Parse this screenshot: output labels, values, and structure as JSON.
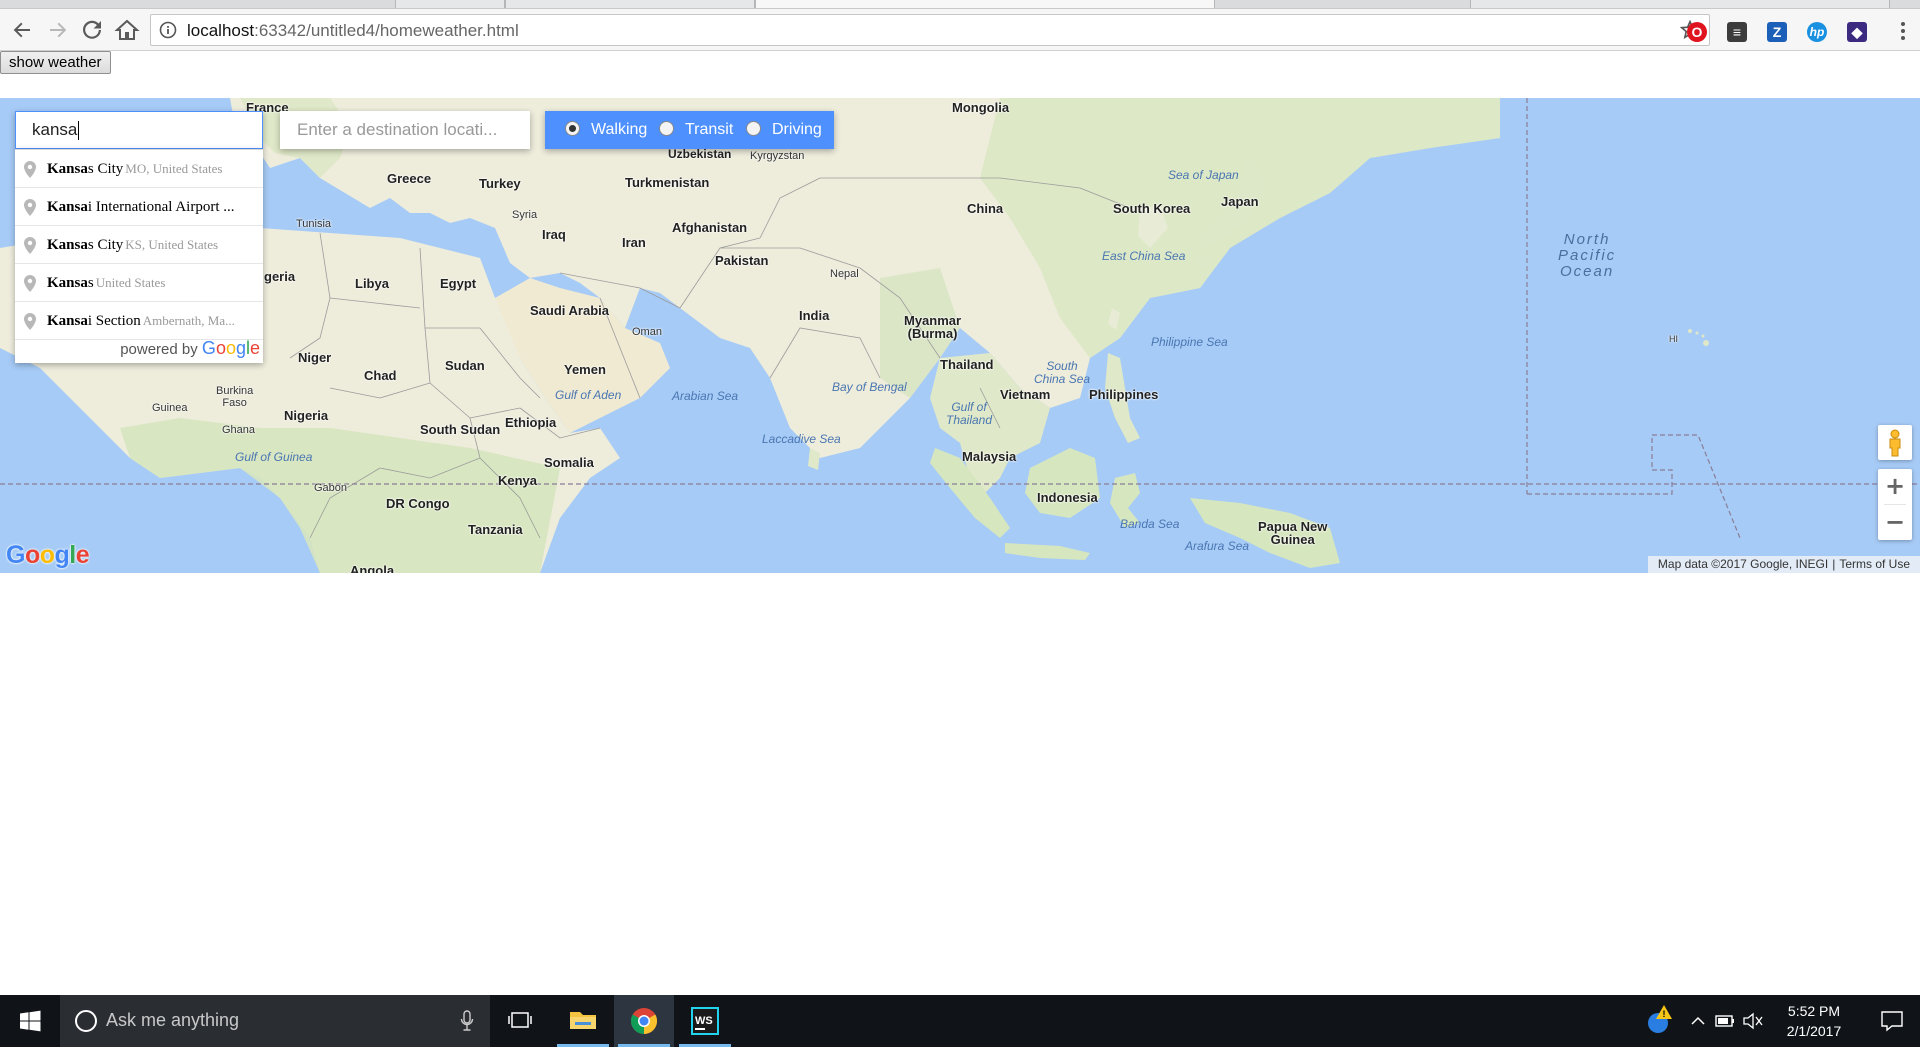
{
  "browser": {
    "url_host": "localhost",
    "url_path": ":63342/untitled4/homeweather.html"
  },
  "page": {
    "show_weather_label": "show weather"
  },
  "search": {
    "origin_value": "kansa",
    "destination_placeholder": "Enter a destination locati...",
    "modes": [
      {
        "label": "Walking",
        "checked": true
      },
      {
        "label": "Transit",
        "checked": false
      },
      {
        "label": "Driving",
        "checked": false
      }
    ],
    "suggestions": [
      {
        "match": "Kansa",
        "rest": "s City",
        "secondary": "MO, United States"
      },
      {
        "match": "Kansa",
        "rest": "i International Airport ...",
        "secondary": ""
      },
      {
        "match": "Kansa",
        "rest": "s City",
        "secondary": "KS, United States"
      },
      {
        "match": "Kansa",
        "rest": "s",
        "secondary": "United States"
      },
      {
        "match": "Kansa",
        "rest": "i Section",
        "secondary": "Ambernath, Ma..."
      }
    ],
    "powered_by": "powered by",
    "google_text": "Google"
  },
  "map": {
    "labels": {
      "france": "France",
      "mongolia": "Mongolia",
      "uzbekistan": "Uzbekistan",
      "kyrgyzstan": "Kyrgyzstan",
      "greece": "Greece",
      "turkey": "Turkey",
      "turkmenistan": "Turkmenistan",
      "sea_of_japan": "Sea of Japan",
      "japan": "Japan",
      "china": "China",
      "south_korea": "South Korea",
      "tunisia": "Tunisia",
      "syria": "Syria",
      "iraq": "Iraq",
      "afghanistan": "Afghanistan",
      "iran": "Iran",
      "pakistan": "Pakistan",
      "east_china_sea": "East China Sea",
      "nepal": "Nepal",
      "algeria": "geria",
      "libya": "Libya",
      "egypt": "Egypt",
      "saudi_arabia": "Saudi Arabia",
      "oman": "Oman",
      "india": "India",
      "myanmar": "Myanmar\n(Burma)",
      "philippine_sea": "Philippine Sea",
      "hi": "HI",
      "niger": "Niger",
      "chad": "Chad",
      "sudan": "Sudan",
      "yemen": "Yemen",
      "thailand": "Thailand",
      "south_china_sea": "South\nChina Sea",
      "burkina_faso": "Burkina\nFaso",
      "gulf_of_aden": "Gulf of Aden",
      "arabian_sea": "Arabian Sea",
      "bay_of_bengal": "Bay of Bengal",
      "vietnam": "Vietnam",
      "philippines": "Philippines",
      "nigeria": "Nigeria",
      "guinea": "Guinea",
      "ethiopia": "Ethiopia",
      "gulf_of_thailand": "Gulf of\nThailand",
      "ghana": "Ghana",
      "south_sudan": "South Sudan",
      "laccadive_sea": "Laccadive Sea",
      "gulf_of_guinea": "Gulf of Guinea",
      "somalia": "Somalia",
      "malaysia": "Malaysia",
      "kenya": "Kenya",
      "gabon": "Gabon",
      "dr_congo": "DR Congo",
      "indonesia": "Indonesia",
      "tanzania": "Tanzania",
      "banda_sea": "Banda Sea",
      "papua_new_guinea": "Papua New\nGuinea",
      "arafura_sea": "Arafura Sea",
      "angola": "Angola",
      "north_pacific_ocean": "North\nPacific\nOcean"
    },
    "attribution": "Map data ©2017 Google, INEGI",
    "terms": "Terms of Use",
    "logo": "Google"
  },
  "taskbar": {
    "search_placeholder": "Ask me anything",
    "time": "5:52 PM",
    "date": "2/1/2017"
  },
  "colors": {
    "water": "#a6cbf6",
    "land": "#eeecdb",
    "accent_blue": "#4d90fe",
    "taskbar": "#101418"
  }
}
